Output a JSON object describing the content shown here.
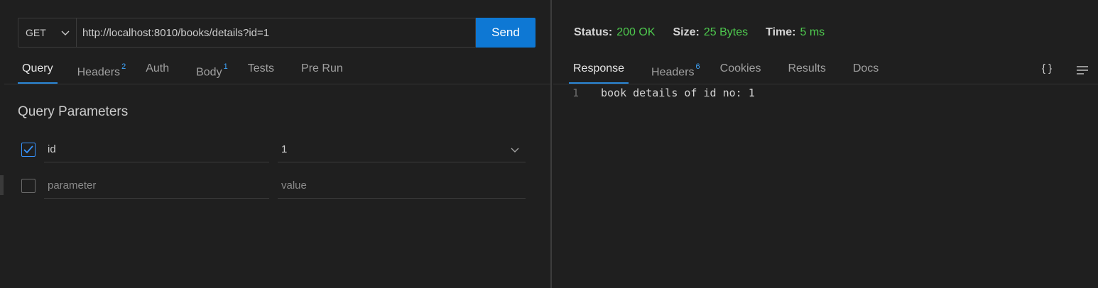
{
  "request": {
    "method": "GET",
    "url": "http://localhost:8010/books/details?id=1",
    "send_label": "Send"
  },
  "request_tabs": [
    {
      "label": "Query",
      "badge": "",
      "active": true
    },
    {
      "label": "Headers",
      "badge": "2",
      "active": false
    },
    {
      "label": "Auth",
      "badge": "",
      "active": false
    },
    {
      "label": "Body",
      "badge": "1",
      "active": false
    },
    {
      "label": "Tests",
      "badge": "",
      "active": false
    },
    {
      "label": "Pre Run",
      "badge": "",
      "active": false
    }
  ],
  "query": {
    "title": "Query Parameters",
    "params": [
      {
        "checked": true,
        "name": "id",
        "value": "1"
      }
    ],
    "new_row": {
      "name_placeholder": "parameter",
      "value_placeholder": "value"
    }
  },
  "status": {
    "status_label": "Status:",
    "status_value": "200 OK",
    "size_label": "Size:",
    "size_value": "25 Bytes",
    "time_label": "Time:",
    "time_value": "5 ms"
  },
  "response_tabs": [
    {
      "label": "Response",
      "badge": "",
      "active": true
    },
    {
      "label": "Headers",
      "badge": "6",
      "active": false
    },
    {
      "label": "Cookies",
      "badge": "",
      "active": false
    },
    {
      "label": "Results",
      "badge": "",
      "active": false
    },
    {
      "label": "Docs",
      "badge": "",
      "active": false
    }
  ],
  "response_toolbar": {
    "format_icon_glyph": "{ }",
    "format_icon": "braces-icon",
    "wrap_icon": "wrap-lines-icon"
  },
  "response_body": {
    "lines": [
      {
        "num": "1",
        "text": "book details of id no: 1"
      }
    ]
  },
  "colors": {
    "accent": "#0e78d4",
    "status_ok": "#4ec94e",
    "background": "#1f1f1f"
  }
}
